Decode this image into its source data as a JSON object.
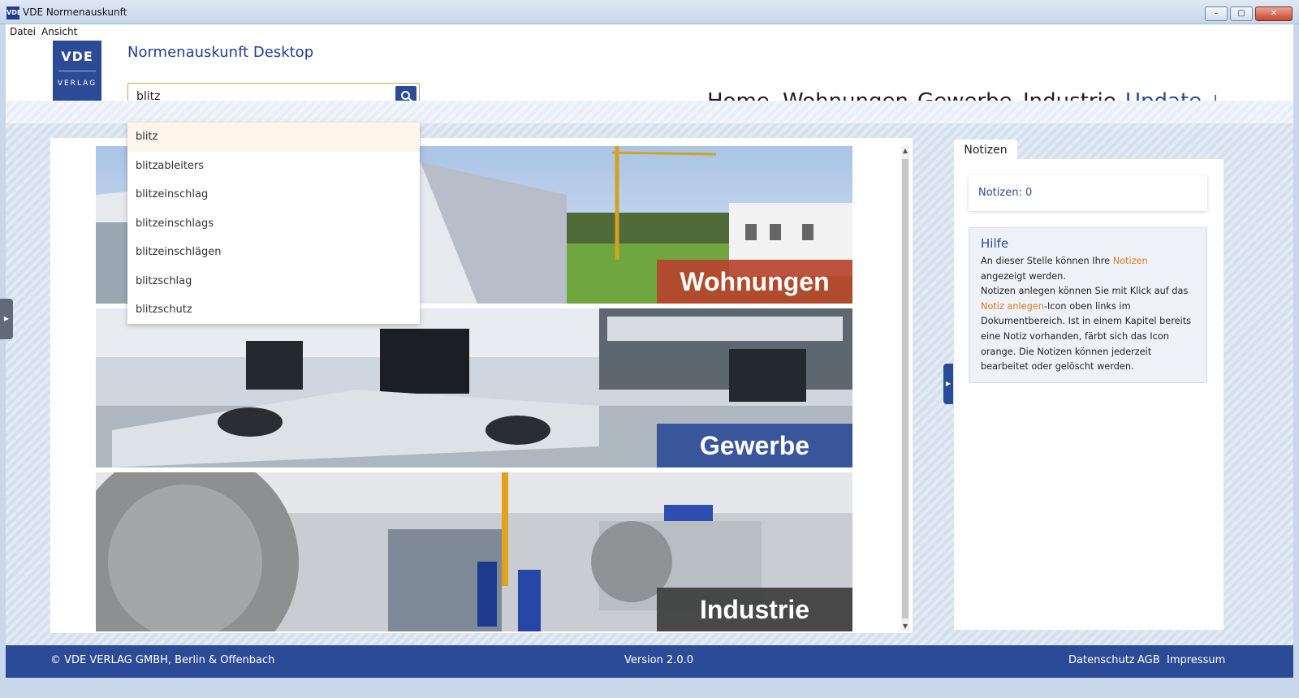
{
  "window": {
    "title": "VDE Normenauskunft",
    "app_icon": "VDE",
    "controls": [
      "–",
      "▢",
      "✕"
    ]
  },
  "menu": {
    "file": "Datei",
    "view": "Ansicht"
  },
  "header": {
    "logo_top": "VDE",
    "logo_bottom": "VERLAG",
    "app_name": "Normenauskunft Desktop",
    "search_value": "blitz",
    "nav": {
      "home": "Home",
      "wohnungen": "Wohnungen",
      "gewerbe": "Gewerbe",
      "industrie": "Industrie",
      "update": "Update"
    }
  },
  "suggestions": [
    "blitz",
    "blitzableiters",
    "blitzeinschlag",
    "blitzeinschlags",
    "blitzeinschlägen",
    "blitzschlag",
    "blitzschutz"
  ],
  "tiles": [
    {
      "label": "Wohnungen",
      "accent": "#b7412b"
    },
    {
      "label": "Gewerbe",
      "accent": "#2c4b96"
    },
    {
      "label": "Industrie",
      "accent": "#3a3a3a"
    }
  ],
  "notes": {
    "tab": "Notizen",
    "count": "Notizen: 0",
    "help_title": "Hilfe",
    "help_p1_a": "An dieser Stelle können Ihre ",
    "help_p1_hl": "Notizen",
    "help_p1_b": " angezeigt werden.",
    "help_p2_a": "Notizen anlegen können Sie mit Klick auf das ",
    "help_p2_hl": "Notiz anlegen",
    "help_p2_b": "-Icon oben links im Dokumentbereich. Ist in einem Kapitel bereits eine Notiz vorhanden, färbt sich das Icon orange. Die Notizen können jederzeit bearbeitet oder gelöscht werden."
  },
  "footer": {
    "copyright": "© VDE VERLAG GMBH, Berlin & Offenbach",
    "version": "Version 2.0.0",
    "privacy": "Datenschutz",
    "terms": "AGB",
    "imprint": "Impressum"
  },
  "colors": {
    "brand": "#2c4b96",
    "highlight": "#d97c1a"
  }
}
